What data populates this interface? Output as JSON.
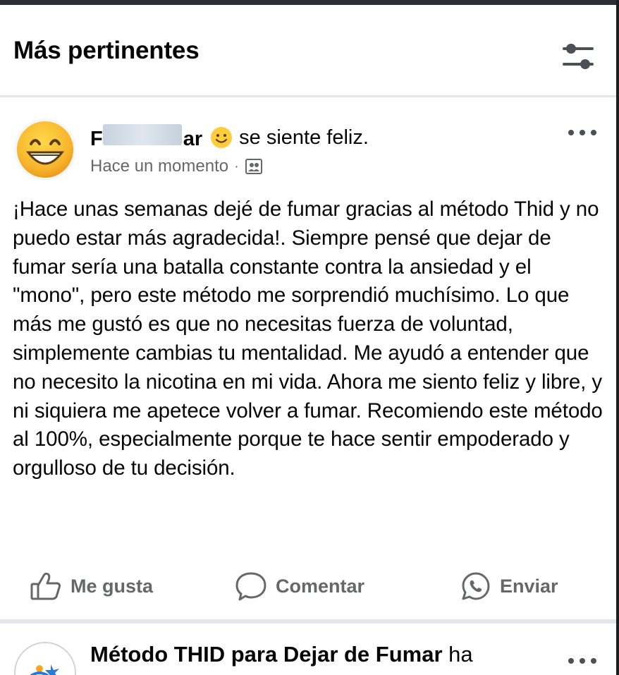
{
  "section": {
    "title": "Más pertinentes"
  },
  "post": {
    "author_visible": "ar",
    "feeling": "se siente feliz.",
    "time": "Hace un momento",
    "meta_separator": "·",
    "text": "¡Hace unas semanas dejé de fumar gracias al método Thid y no puedo estar más agradecida!. Siempre pensé que dejar de fumar sería una batalla constante contra la ansiedad y el \"mono\", pero este método me sorprendió muchísimo. Lo que más me gustó es que no necesitas fuerza de voluntad, simplemente cambias tu mentalidad. Me ayudó a entender que no necesito la nicotina en mi vida. Ahora me siento feliz y libre, y ni siquiera me apetece volver a fumar. Recomiendo este método al 100%, especialmente porque te hace sentir empoderado y orgulloso de tu decisión.",
    "actions": {
      "like": "Me gusta",
      "comment": "Comentar",
      "send": "Enviar"
    }
  },
  "next_post": {
    "page_name": "Método THID para Dejar de Fumar",
    "action_text": "ha"
  },
  "icons": {
    "filter": "sliders-icon",
    "more": "more-horizontal-icon",
    "feeling": "smiling-face-icon",
    "audience": "friends-audience-icon",
    "like": "thumbs-up-icon",
    "comment": "comment-bubble-icon",
    "send": "whatsapp-icon"
  },
  "colors": {
    "text_primary": "#050505",
    "text_secondary": "#65676b",
    "divider": "#e4e6eb"
  }
}
